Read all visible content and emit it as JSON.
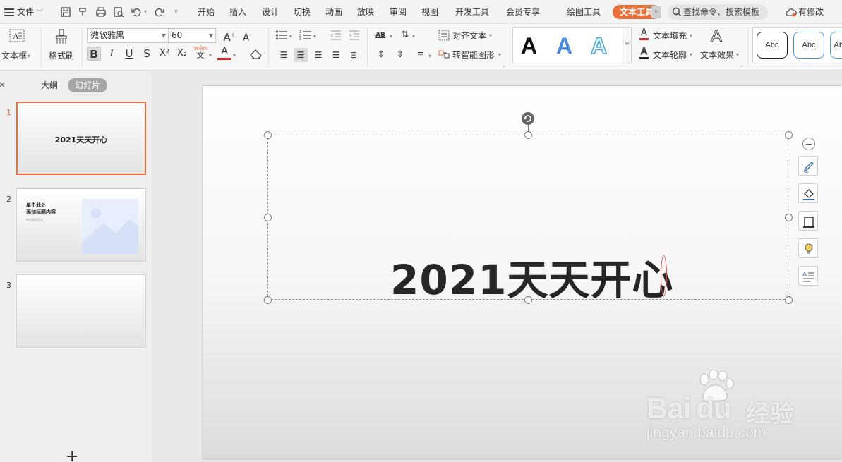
{
  "menubar": {
    "file": "文件",
    "tabs": [
      {
        "label": "开始"
      },
      {
        "label": "插入"
      },
      {
        "label": "设计"
      },
      {
        "label": "切换"
      },
      {
        "label": "动画"
      },
      {
        "label": "放映"
      },
      {
        "label": "审阅"
      },
      {
        "label": "视图"
      },
      {
        "label": "开发工具"
      },
      {
        "label": "会员专享"
      }
    ],
    "drawing_tools": "绘图工具",
    "text_tools": "文本工具",
    "search_placeholder": "查找命令、搜索模板",
    "cloud_status": "有修改",
    "accent_color": "#e8703a"
  },
  "ribbon": {
    "textbox_label": "文本框",
    "format_painter_label": "格式刷",
    "font_name": "微软雅黑",
    "font_size": "60",
    "align_text": "对齐文本",
    "smart_shape": "转智能图形",
    "text_fill": "文本填充",
    "text_outline": "文本轮廓",
    "text_effect": "文本效果",
    "style_letter": "A",
    "shape_style_label": "Abc",
    "char_b": "B",
    "char_i": "I",
    "char_u": "U",
    "char_s": "S",
    "char_super": "X²",
    "char_sub": "X₂",
    "phonetic": "wén",
    "font_color_letter": "A",
    "ab_label": "AB"
  },
  "leftpanel": {
    "tab_outline": "大纲",
    "tab_slides": "幻灯片",
    "slides": [
      {
        "num": "1",
        "title": "2021天天开心"
      },
      {
        "num": "2",
        "title": "单击此处添加标题内容",
        "title_line1": "单击此处",
        "title_line2": "添加标题内容",
        "subtitle": "单击添加正文"
      },
      {
        "num": "3",
        "title": ""
      }
    ],
    "add": "+"
  },
  "slide": {
    "title": "2021天天开心"
  },
  "watermark": {
    "brand": "Bai",
    "brand2": "du",
    "cn": "经验",
    "url": "jingyan.baidu.com"
  }
}
